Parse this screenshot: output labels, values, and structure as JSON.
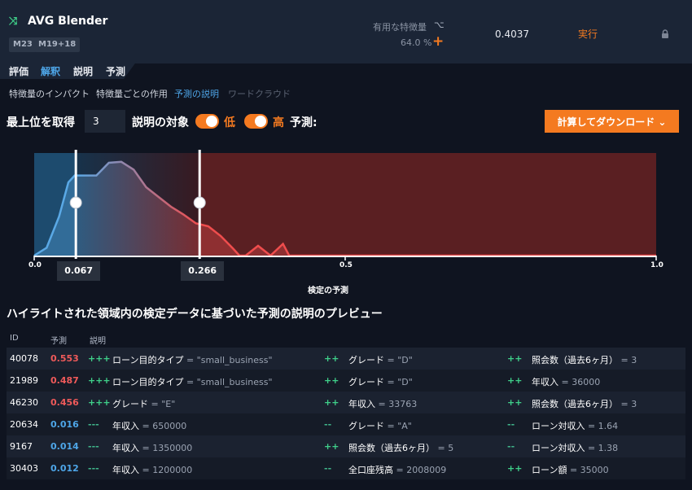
{
  "header": {
    "model_name": "AVG Blender",
    "tags": [
      "M23",
      "M19+18"
    ],
    "useful_features_label": "有用な特徴量",
    "useful_features_pct": "64.0 %",
    "score": "0.4037",
    "run_label": "実行"
  },
  "main_tabs": [
    {
      "label": "評価",
      "active": false
    },
    {
      "label": "解釈",
      "active": true
    },
    {
      "label": "説明",
      "active": false
    },
    {
      "label": "予測",
      "active": false
    }
  ],
  "sub_tabs": [
    {
      "label": "特徴量のインパクト",
      "state": "normal"
    },
    {
      "label": "特徴量ごとの作用",
      "state": "normal"
    },
    {
      "label": "予測の説明",
      "state": "active"
    },
    {
      "label": "ワードクラウド",
      "state": "disabled"
    }
  ],
  "controls": {
    "top_label": "最上位を取得",
    "top_value": "3",
    "target_label": "説明の対象",
    "low_label": "低",
    "high_label": "高",
    "pred_label": "予測:",
    "download_label": "計算してダウンロード"
  },
  "chart_data": {
    "type": "area",
    "x": [
      0.0,
      0.02,
      0.04,
      0.055,
      0.065,
      0.08,
      0.1,
      0.12,
      0.14,
      0.16,
      0.18,
      0.2,
      0.22,
      0.24,
      0.26,
      0.28,
      0.3,
      0.32,
      0.33,
      0.34,
      0.36,
      0.38,
      0.4,
      0.41,
      1.0
    ],
    "values": [
      0.0,
      0.08,
      0.4,
      0.75,
      0.82,
      0.82,
      0.82,
      0.95,
      0.96,
      0.88,
      0.7,
      0.6,
      0.5,
      0.42,
      0.33,
      0.3,
      0.2,
      0.07,
      0.0,
      0.0,
      0.1,
      0.0,
      0.12,
      0.0,
      0.0
    ],
    "xlim": [
      0.0,
      1.0
    ],
    "ticks": [
      {
        "value": 0.0,
        "label": "0.0"
      },
      {
        "value": 0.5,
        "label": "0.5"
      },
      {
        "value": 1.0,
        "label": "1.0"
      }
    ],
    "low_threshold": 0.067,
    "high_threshold": 0.266,
    "low_threshold_label": "0.067",
    "high_threshold_label": "0.266",
    "xlabel": "検定の予測",
    "colors": {
      "low_region": "#1d4b6e",
      "high_region": "#5a1f22",
      "low_curve": "#5aa9e6",
      "high_curve": "#ef4d4d"
    }
  },
  "preview": {
    "title": "ハイライトされた領域内の検定データに基づいた予測の説明のプレビュー",
    "headers": {
      "id": "ID",
      "pred": "予測",
      "expl": "説明"
    },
    "rows": [
      {
        "id": "40078",
        "pred": "0.553",
        "level": "high",
        "expl": [
          {
            "strength": "+++",
            "name": "ローン目的タイプ",
            "value": " = \"small_business\""
          },
          {
            "strength": "++",
            "name": "グレード",
            "value": " = \"D\""
          },
          {
            "strength": "++",
            "name": "照会数（過去6ヶ月）",
            "value": " = 3"
          }
        ]
      },
      {
        "id": "21989",
        "pred": "0.487",
        "level": "high",
        "expl": [
          {
            "strength": "+++",
            "name": "ローン目的タイプ",
            "value": " = \"small_business\""
          },
          {
            "strength": "++",
            "name": "グレード",
            "value": " = \"D\""
          },
          {
            "strength": "++",
            "name": "年収入",
            "value": " = 36000"
          }
        ]
      },
      {
        "id": "46230",
        "pred": "0.456",
        "level": "high",
        "expl": [
          {
            "strength": "+++",
            "name": "グレード",
            "value": " = \"E\""
          },
          {
            "strength": "++",
            "name": "年収入",
            "value": " = 33763"
          },
          {
            "strength": "++",
            "name": "照会数（過去6ヶ月）",
            "value": " = 3"
          }
        ]
      },
      {
        "id": "20634",
        "pred": "0.016",
        "level": "low",
        "expl": [
          {
            "strength": "---",
            "name": "年収入",
            "value": " = 650000"
          },
          {
            "strength": "--",
            "name": "グレード",
            "value": " = \"A\""
          },
          {
            "strength": "--",
            "name": "ローン対収入",
            "value": " = 1.64"
          }
        ]
      },
      {
        "id": "9167",
        "pred": "0.014",
        "level": "low",
        "expl": [
          {
            "strength": "---",
            "name": "年収入",
            "value": " = 1350000"
          },
          {
            "strength": "++",
            "name": "照会数（過去6ヶ月）",
            "value": " = 5"
          },
          {
            "strength": "--",
            "name": "ローン対収入",
            "value": " = 1.38"
          }
        ]
      },
      {
        "id": "30403",
        "pred": "0.012",
        "level": "low",
        "expl": [
          {
            "strength": "---",
            "name": "年収入",
            "value": " = 1200000"
          },
          {
            "strength": "--",
            "name": "全口座残高",
            "value": " = 2008009"
          },
          {
            "strength": "++",
            "name": "ローン額",
            "value": " = 35000"
          }
        ]
      }
    ]
  }
}
